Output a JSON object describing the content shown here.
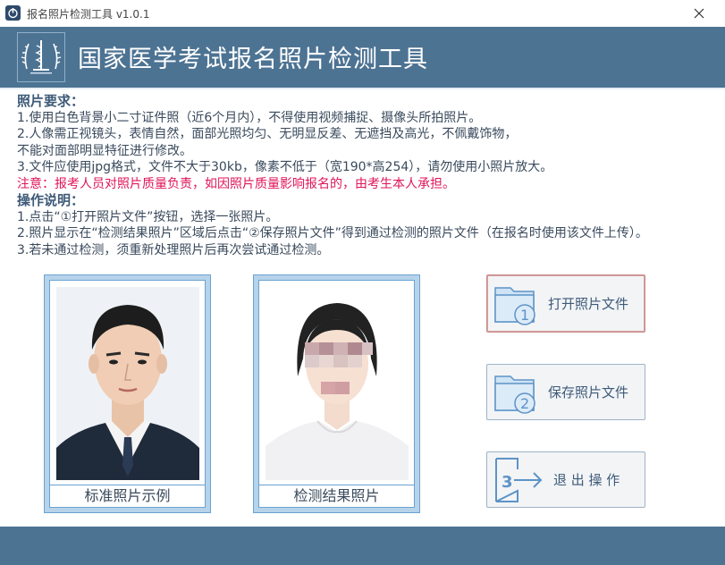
{
  "window": {
    "title": "报名照片检测工具 v1.0.1",
    "icon": "power-app-icon"
  },
  "header": {
    "title": "国家医学考试报名照片检测工具",
    "logo": "medical-exam-emblem"
  },
  "requirements": {
    "heading": "照片要求：",
    "lines": [
      "1.使用白色背景小二寸证件照（近6个月内），不得使用视频捕捉、摄像头所拍照片。",
      "2.人像需正视镜头，表情自然，面部光照均匀、无明显反差、无遮挡及高光，不佩戴饰物，",
      "不能对面部明显特征进行修改。",
      "3.文件应使用jpg格式，文件不大于30kb，像素不低于（宽190*高254），请勿使用小照片放大。"
    ],
    "warning": "注意：报考人员对照片质量负责，如因照片质量影响报名的，由考生本人承担。"
  },
  "instructions": {
    "heading": "操作说明：",
    "lines": [
      "1.点击“①打开照片文件”按钮，选择一张照片。",
      "2.照片显示在“检测结果照片”区域后点击“②保存照片文件”得到通过检测的照片文件（在报名时使用该文件上传）。",
      "3.若未通过检测，须重新处理照片后再次尝试通过检测。"
    ]
  },
  "photos": {
    "sample_caption": "标准照片示例",
    "result_caption": "检测结果照片"
  },
  "buttons": {
    "open": "打开照片文件",
    "save": "保存照片文件",
    "exit": "退 出 操 作"
  },
  "colors": {
    "banner": "#4d7393",
    "warning": "#e0145a",
    "frame": "#b7d3ea"
  }
}
